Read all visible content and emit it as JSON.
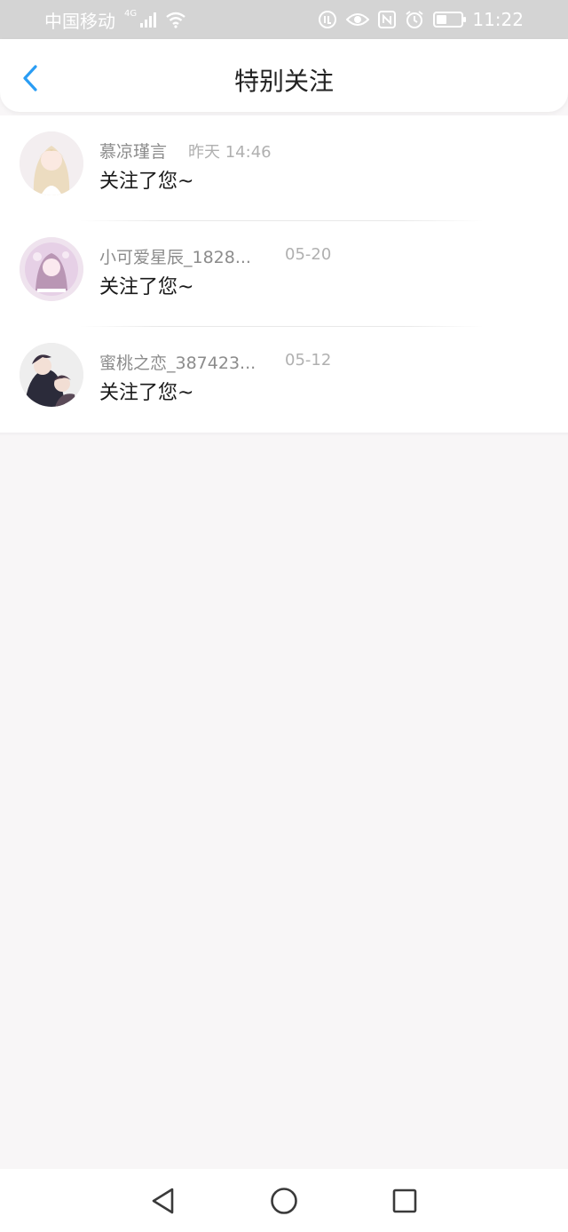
{
  "status_bar": {
    "carrier": "中国移动",
    "network": "4G",
    "time": "11:22",
    "icons": [
      "signal-icon",
      "wifi-icon",
      "data-saver-icon",
      "eye-icon",
      "nfc-icon",
      "alarm-icon",
      "battery-icon"
    ]
  },
  "header": {
    "title": "特别关注",
    "back_icon": "chevron-left-icon",
    "accent_color": "#2a9df4"
  },
  "notifications": [
    {
      "name": "慕凉瑾言",
      "time": "昨天 14:46",
      "message": "关注了您~"
    },
    {
      "name": "小可爱星辰_1828...",
      "time": "05-20",
      "message": "关注了您~"
    },
    {
      "name": "蜜桃之恋_387423...",
      "time": "05-12",
      "message": "关注了您~"
    }
  ],
  "nav_bar": {
    "buttons": [
      "back-triangle-icon",
      "home-circle-icon",
      "recents-square-icon"
    ]
  }
}
